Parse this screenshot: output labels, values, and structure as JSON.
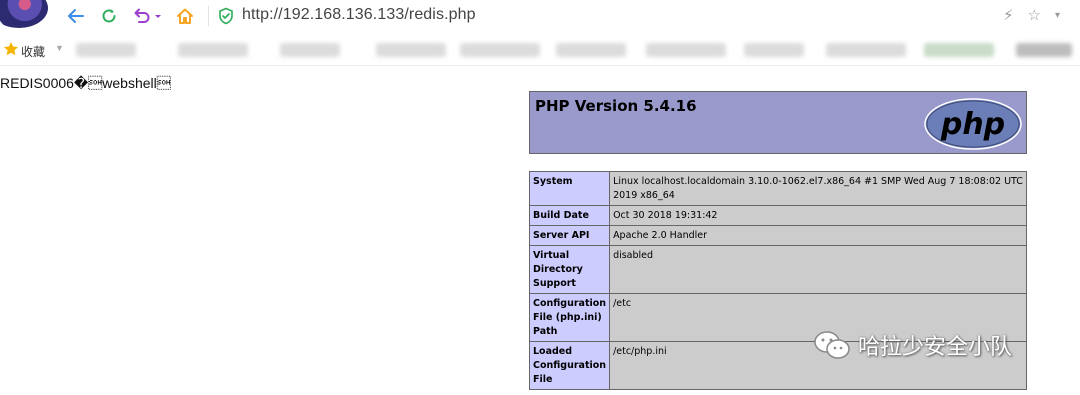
{
  "browser": {
    "url": "http://192.168.136.133/redis.php",
    "bookmark_label": "收藏"
  },
  "page": {
    "redis_output": "REDIS0006�\u0001webshell\u0001",
    "php_version_title": "PHP Version 5.4.16",
    "logo_text": "php",
    "info_rows": [
      {
        "key": "System",
        "value": "Linux localhost.localdomain 3.10.0-1062.el7.x86_64 #1 SMP Wed Aug 7 18:08:02 UTC 2019 x86_64"
      },
      {
        "key": "Build Date",
        "value": "Oct 30 2018 19:31:42"
      },
      {
        "key": "Server API",
        "value": "Apache 2.0 Handler"
      },
      {
        "key": "Virtual Directory Support",
        "value": "disabled"
      },
      {
        "key": "Configuration File (php.ini) Path",
        "value": "/etc"
      },
      {
        "key": "Loaded Configuration File",
        "value": "/etc/php.ini"
      }
    ],
    "watermark": "哈拉少安全小队"
  },
  "colors": {
    "php_header_bg": "#9999cc",
    "key_cell_bg": "#ccccff",
    "value_cell_bg": "#cccccc",
    "nav_icon_blue": "#3b8ee8",
    "reload_green": "#2eae5a",
    "menu_purple": "#9b3fd1",
    "home_orange": "#f5a623"
  }
}
